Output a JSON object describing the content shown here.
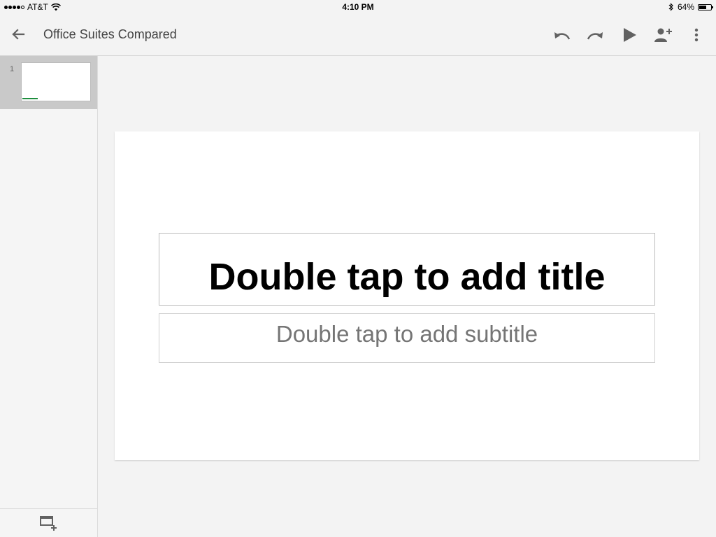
{
  "status_bar": {
    "carrier": "AT&T",
    "time": "4:10 PM",
    "battery": "64%",
    "battery_level": 0.64
  },
  "app_bar": {
    "title": "Office Suites Compared",
    "icons": [
      "back-arrow-icon",
      "undo-icon",
      "redo-icon",
      "present-play-icon",
      "add-person-icon",
      "more-vert-icon"
    ]
  },
  "sidebar": {
    "slides": [
      {
        "number": "1"
      }
    ],
    "accent_color": "#1e8e3e"
  },
  "slide": {
    "title_placeholder": "Double tap to add title",
    "subtitle_placeholder": "Double tap to add subtitle"
  }
}
